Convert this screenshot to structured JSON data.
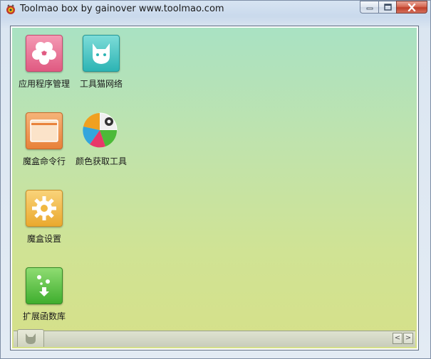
{
  "window": {
    "title": "Toolmao box by gainover www.toolmao.com",
    "icon": "toolmao-cat-icon"
  },
  "caption_buttons": [
    {
      "name": "minimize-button",
      "icon": "minimize-icon"
    },
    {
      "name": "maximize-button",
      "icon": "maximize-icon"
    },
    {
      "name": "close-button",
      "icon": "close-icon"
    }
  ],
  "tiles": [
    {
      "label": "应用程序管理",
      "icon": "clover-icon",
      "color": "#e86890"
    },
    {
      "label": "工具猫网络",
      "icon": "cat-head-icon",
      "color": "#3cbcbc"
    },
    {
      "label": "魔盒命令行",
      "icon": "console-window-icon",
      "color": "#ee9148"
    },
    {
      "label": "颜色获取工具",
      "icon": "color-pie-icon",
      "color": "#f0a020"
    },
    {
      "label": "魔盒设置",
      "icon": "gear-icon",
      "color": "#efb540"
    },
    {
      "label": "扩展函数库",
      "icon": "download-arrow-icon",
      "color": "#4cba38"
    }
  ],
  "bottom_bar": {
    "tab_icon": "cat-head-icon",
    "scroll_left": "<",
    "scroll_right": ">"
  }
}
